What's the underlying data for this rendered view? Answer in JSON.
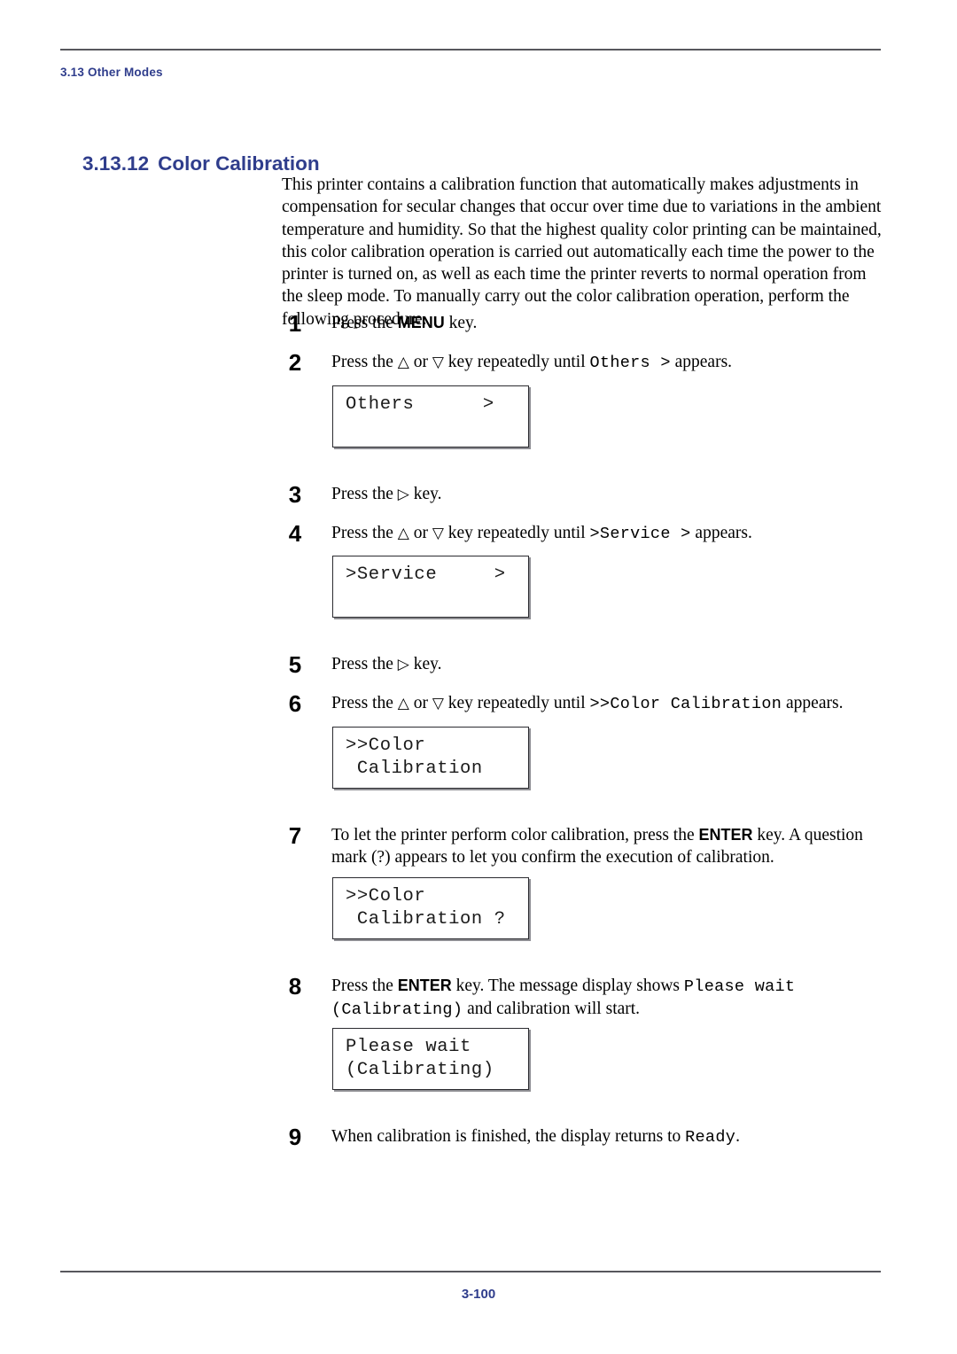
{
  "document": {
    "running_head": "3.13 Other Modes",
    "folio": "3-100",
    "accent_color": "#2f3d8c",
    "rule_color": "#58585d"
  },
  "section": {
    "number": "3.13.12",
    "title": "Color Calibration"
  },
  "intro": {
    "paragraph": "This printer contains a calibration function that automatically makes adjustments in compensation for secular changes that occur over time due to variations in the ambient temperature and humidity. So that the highest quality color printing can be maintained, this color calibration operation is carried out automatically each time the power to the printer is turned on, as well as each time the printer reverts to normal operation from the sleep mode. To manually carry out the color calibration operation, perform the following procedure."
  },
  "glyphs": {
    "up_key": "△",
    "down_key": "▽",
    "right_key": "▷"
  },
  "steps": [
    {
      "number": "1",
      "parts": [
        {
          "kind": "text",
          "value": "Press the "
        },
        {
          "kind": "key",
          "value": "MENU"
        },
        {
          "kind": "text",
          "value": " key."
        }
      ]
    },
    {
      "number": "2",
      "parts": [
        {
          "kind": "text",
          "value": "Press the "
        },
        {
          "kind": "tri",
          "value": "△"
        },
        {
          "kind": "text",
          "value": " or "
        },
        {
          "kind": "tri",
          "value": "▽"
        },
        {
          "kind": "text",
          "value": " key repeatedly until "
        },
        {
          "kind": "mono",
          "value": "Others >"
        },
        {
          "kind": "text",
          "value": " appears."
        }
      ]
    },
    {
      "number": "3",
      "parts": [
        {
          "kind": "text",
          "value": "Press the "
        },
        {
          "kind": "tri",
          "value": "▷"
        },
        {
          "kind": "text",
          "value": " key."
        }
      ]
    },
    {
      "number": "4",
      "parts": [
        {
          "kind": "text",
          "value": "Press the "
        },
        {
          "kind": "tri",
          "value": "△"
        },
        {
          "kind": "text",
          "value": " or "
        },
        {
          "kind": "tri",
          "value": "▽"
        },
        {
          "kind": "text",
          "value": " key repeatedly until "
        },
        {
          "kind": "mono",
          "value": ">Service >"
        },
        {
          "kind": "text",
          "value": " appears."
        }
      ]
    },
    {
      "number": "5",
      "parts": [
        {
          "kind": "text",
          "value": "Press the "
        },
        {
          "kind": "tri",
          "value": "▷"
        },
        {
          "kind": "text",
          "value": " key."
        }
      ]
    },
    {
      "number": "6",
      "parts": [
        {
          "kind": "text",
          "value": "Press the "
        },
        {
          "kind": "tri",
          "value": "△"
        },
        {
          "kind": "text",
          "value": " or "
        },
        {
          "kind": "tri",
          "value": "▽"
        },
        {
          "kind": "text",
          "value": " key repeatedly until "
        },
        {
          "kind": "mono",
          "value": ">>Color Calibration"
        },
        {
          "kind": "text",
          "value": " appears."
        }
      ]
    },
    {
      "number": "7",
      "parts": [
        {
          "kind": "text",
          "value": "To let the printer perform color calibration, press the "
        },
        {
          "kind": "key",
          "value": "ENTER"
        },
        {
          "kind": "text",
          "value": " key. A question mark (?) appears to let you confirm the execution of calibration."
        }
      ]
    },
    {
      "number": "8",
      "parts": [
        {
          "kind": "text",
          "value": "Press the "
        },
        {
          "kind": "key",
          "value": "ENTER"
        },
        {
          "kind": "text",
          "value": " key. The message display shows "
        },
        {
          "kind": "mono",
          "value": "Please wait"
        },
        {
          "kind": "text",
          "value": " "
        },
        {
          "kind": "mono",
          "value": "(Calibrating)"
        },
        {
          "kind": "text",
          "value": " and calibration will start."
        }
      ]
    },
    {
      "number": "9",
      "parts": [
        {
          "kind": "text",
          "value": "When calibration is finished, the display returns to "
        },
        {
          "kind": "mono",
          "value": "Ready"
        },
        {
          "kind": "text",
          "value": "."
        }
      ]
    }
  ],
  "lcd_panels": [
    {
      "id": "panel-others",
      "line1": "Others      >",
      "line2": ""
    },
    {
      "id": "panel-service",
      "line1": ">Service     >",
      "line2": ""
    },
    {
      "id": "panel-color-calibration",
      "line1": ">>Color",
      "line2": " Calibration"
    },
    {
      "id": "panel-color-calibration-confirm",
      "line1": ">>Color",
      "line2": " Calibration ?"
    },
    {
      "id": "panel-please-wait",
      "line1": "Please wait",
      "line2": "(Calibrating)"
    }
  ]
}
